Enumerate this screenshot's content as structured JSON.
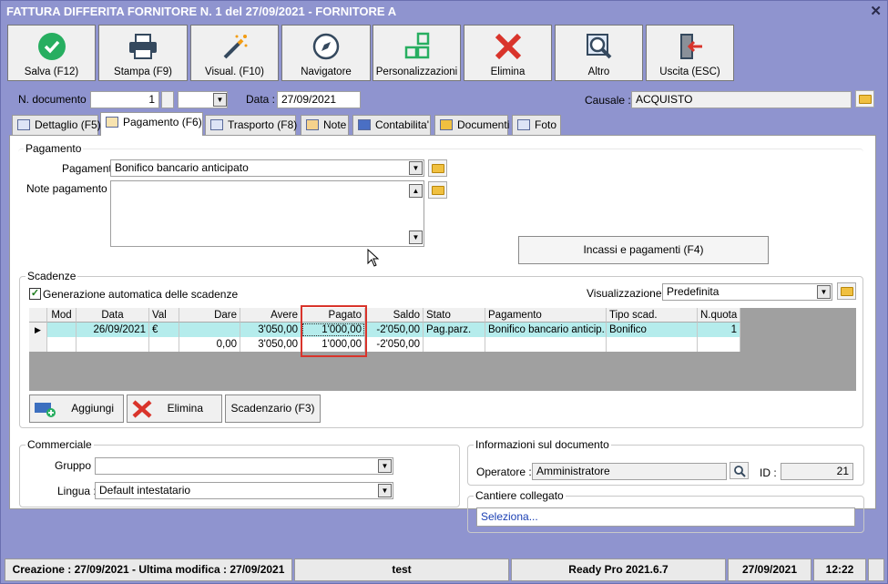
{
  "window": {
    "title": "FATTURA DIFFERITA FORNITORE N. 1 del 27/09/2021 - FORNITORE A",
    "close_icon": "close-icon"
  },
  "toolbar": [
    {
      "label": "Salva (F12)",
      "icon": "checkmark-icon"
    },
    {
      "label": "Stampa (F9)",
      "icon": "printer-icon"
    },
    {
      "label": "Visual. (F10)",
      "icon": "magic-wand-icon"
    },
    {
      "label": "Navigatore",
      "icon": "compass-icon"
    },
    {
      "label": "Personalizzazioni",
      "icon": "grid-icon"
    },
    {
      "label": "Elimina",
      "icon": "red-x-icon"
    },
    {
      "label": "Altro",
      "icon": "magnifier-icon"
    },
    {
      "label": "Uscita (ESC)",
      "icon": "exit-door-icon"
    }
  ],
  "header": {
    "ndoc_label": "N. documento :",
    "ndoc_value": "1",
    "data_label": "Data :",
    "data_value": "27/09/2021",
    "causale_label": "Causale :",
    "causale_value": "ACQUISTO"
  },
  "tabs": [
    "Dettaglio (F5)",
    "Pagamento (F6)",
    "Trasporto (F8)",
    "Note",
    "Contabilita'",
    "Documenti",
    "Foto"
  ],
  "pagamento": {
    "group": "Pagamento",
    "label": "Pagamento :",
    "value": "Bonifico bancario anticipato",
    "note_label": "Note pagamento :",
    "note_value": "",
    "incassi_button": "Incassi e pagamenti (F4)"
  },
  "scadenze": {
    "group": "Scadenze",
    "auto_label": "Generazione automatica delle scadenze",
    "auto_checked": true,
    "vis_label": "Visualizzazione :",
    "vis_value": "Predefinita",
    "columns": [
      "Mod",
      "Data",
      "Val",
      "Dare",
      "Avere",
      "Pagato",
      "Saldo",
      "Stato",
      "Pagamento",
      "Tipo scad.",
      "N.quota"
    ],
    "rows": [
      {
        "marker": "▶",
        "mod": "",
        "data": "26/09/2021",
        "val": "€",
        "dare": "",
        "avere": "3'050,00",
        "pagato": "1'000,00",
        "saldo": "-2'050,00",
        "stato": "Pag.parz.",
        "pagamento": "Bonifico bancario anticip...",
        "tipo": "Bonifico",
        "nquota": "1"
      },
      {
        "marker": "",
        "mod": "",
        "data": "",
        "val": "",
        "dare": "0,00",
        "avere": "3'050,00",
        "pagato": "1'000,00",
        "saldo": "-2'050,00",
        "stato": "",
        "pagamento": "",
        "tipo": "",
        "nquota": ""
      }
    ],
    "buttons": {
      "aggiungi": "Aggiungi",
      "elimina": "Elimina",
      "scadenzario": "Scadenzario (F3)"
    }
  },
  "commerciale": {
    "group": "Commerciale",
    "gruppo_label": "Gruppo :",
    "gruppo_value": "",
    "lingua_label": "Lingua :",
    "lingua_value": "Default intestatario"
  },
  "info": {
    "group": "Informazioni sul documento",
    "operatore_label": "Operatore :",
    "operatore_value": "Amministratore",
    "id_label": "ID :",
    "id_value": "21"
  },
  "cantiere": {
    "group": "Cantiere collegato",
    "value": "Seleziona..."
  },
  "status": {
    "dates": "Creazione : 27/09/2021 - Ultima modifica : 27/09/2021",
    "user": "test",
    "version": "Ready Pro 2021.6.7",
    "date": "27/09/2021",
    "time": "12:22"
  },
  "colors": {
    "highlight": "#d9342b",
    "row_selected": "#b5ecec",
    "window_bg": "#8f94cf"
  }
}
